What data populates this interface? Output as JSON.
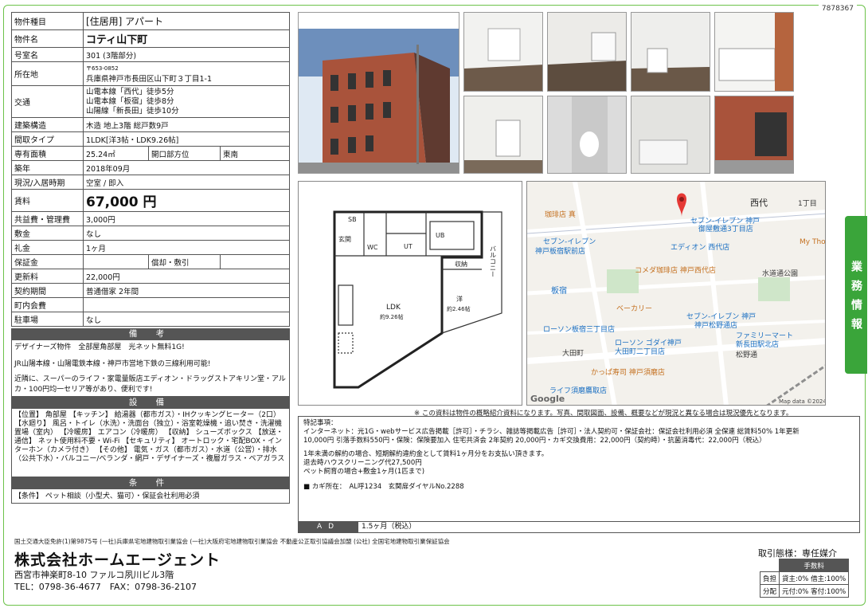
{
  "doc_no": "7878367",
  "property": {
    "rows": [
      {
        "key": "物件種目",
        "value": "[住居用] アパート",
        "big": true
      },
      {
        "key": "物件名",
        "value": "コティ山下町",
        "big": true
      },
      {
        "key": "号室名",
        "value": "301 (3階部分)"
      }
    ],
    "postal": "〒653-0852",
    "address_label": "所在地",
    "address": "兵庫県神戸市長田区山下町３丁目1-1",
    "transport_label": "交通",
    "transport": [
      "山電本線「西代」徒歩5分",
      "山電本線「板宿」徒歩8分",
      "山陽線「新長田」徒歩10分"
    ],
    "structure_label": "建築構造",
    "structure": "木造 地上3階 総戸数9戸",
    "layout_label": "間取タイプ",
    "layout": "1LDK[洋3帖・LDK9.26帖]",
    "area_label": "専有面積",
    "area": "25.24㎡",
    "opening_label": "開口部方位",
    "opening": "東南",
    "built_label": "築年",
    "built": "2018年09月",
    "status_label": "現況/入居時期",
    "status": "空室 / 即入",
    "rent_label": "賃料",
    "rent": "67,000 円",
    "mgmt_label": "共益費・管理費",
    "mgmt": "3,000円",
    "deposit_label": "敷金",
    "deposit": "なし",
    "keymoney_label": "礼金",
    "keymoney": "1ヶ月",
    "guarantee_label": "保証金",
    "guarantee2_label": "償却・敷引",
    "renewal_label": "更新料",
    "renewal": "22,000円",
    "contract_label": "契約期間",
    "contract": "普通借家 2年間",
    "town_label": "町内会費",
    "parking_label": "駐車場",
    "parking": "なし"
  },
  "remarks": {
    "title": "備 考",
    "lines": [
      "デザイナーズ物件　全部屋角部屋　光ネット無料1G!",
      "JR山陽本線・山陽電鉄本線・神戸市営地下鉄の三線利用可能!",
      "近隣に、スーパーのライフ・家電量販店エディオン・ドラッグストアキリン堂・アルカ・100円均一セリア等があり、便利です!"
    ]
  },
  "equipment": {
    "title": "設 備",
    "text": "【位置】 角部屋 【キッチン】 給湯器（都市ガス）・IHクッキングヒーター（2口） 【水廻り】 風呂・トイレ（水洗）・洗面台（独立）・浴室乾燥機・追い焚き・洗濯機置場（室内） 【冷暖房】 エアコン（冷暖房） 【収納】 シューズボックス 【放送・通信】 ネット使用料不要・Wi-Fi 【セキュリティ】 オートロック・宅配BOX・インターホン（カメラ付き） 【その他】 電気・ガス（都市ガス）・水道（公営）・排水（公共下水）・バルコニー/ベランダ・網戸・デザイナーズ・複層ガラス・ペアガラス"
  },
  "conditions": {
    "title": "条 件",
    "text": "【条件】 ペット相談（小型犬、猫可）・保証会社利用必須"
  },
  "floorplan": {
    "sb": "SB",
    "entrance": "玄関",
    "wc": "WC",
    "ut": "UT",
    "ub": "UB",
    "storage": "収納",
    "balcony": "バルコニー",
    "ldk": "LDK",
    "ldk_size": "約9.26帖",
    "western": "洋",
    "western_size": "約2.46帖"
  },
  "map": {
    "labels": [
      "西代",
      "1丁目",
      "珈琲店 真",
      "セブン-イレブン",
      "神戸板宿駅前店",
      "板宿",
      "エディオン 西代店",
      "コメダ珈琲店 神戸西代店",
      "水道通公園",
      "ローソン板宿三丁目店",
      "ローソン ゴダイ神戸",
      "大田町二丁目店",
      "ファミリーマート",
      "新長田駅北店",
      "かっぱ寿司 神戸須磨店",
      "ライフ須磨鷹取店",
      "大田町",
      "松野通",
      "Google",
      "Map data ©2024",
      "My Tho",
      "セブン-イレブン 神戸",
      "御屋敷通3丁目店",
      "神戸松野通店",
      "ベーカリー"
    ]
  },
  "side_label": "業務情報",
  "disclaimer": "※ この資料は物件の概略紹介資料になります。写真、間取図面、設備、概要などが現況と異なる場合は現況優先となります。",
  "special": {
    "title": "特記事項：",
    "lines": [
      "インターネット：光1G・webサービス広告掲載［許可］・チラシ、雑誌等掲載広告［許可］・法人契約可・保証会社：保証会社利用必須 全保連 総賃料50% 1年更新",
      "10,000円 引落手数料550円・保険：保険要加入 住宅共済会 2年契約 20,000円・カギ交換費用：22,000円（契約時）・抗菌消毒代：22,000円（税込）",
      "",
      "1年未満の解約の場合、短期解約違約金として賃料1ヶ月分をお支払い頂きます。",
      "退去時ハウスクリーニング代27,500円",
      "ペット飼育の場合+敷金1ヶ月(1匹まで)",
      "",
      "■ カギ所在：　AL呼1234　玄関扉ダイヤルNo.2288"
    ]
  },
  "ad": {
    "label": "AD",
    "value": "1.5ヶ月（税込）"
  },
  "footer": {
    "license": "国土交通大臣免許(1)第9875号 (一社)兵庫県宅地建物取引業協会 (一社)大阪府宅地建物取引業協会 不動産公正取引協議会加盟 (公社) 全国宅地建物取引業保証協会",
    "company": "株式会社ホームエージェント",
    "address": "西宮市神楽町8-10 ファルコ夙川ビル3階",
    "tel": "TEL：0798-36-4677　FAX：0798-36-2107",
    "deal": "取引態様：専任媒介",
    "fee_title": "手数料",
    "fee_rows": [
      {
        "k": "負担",
        "v": "貸主:0%  借主:100%"
      },
      {
        "k": "分配",
        "v": "元付:0%  客付:100%"
      }
    ]
  }
}
